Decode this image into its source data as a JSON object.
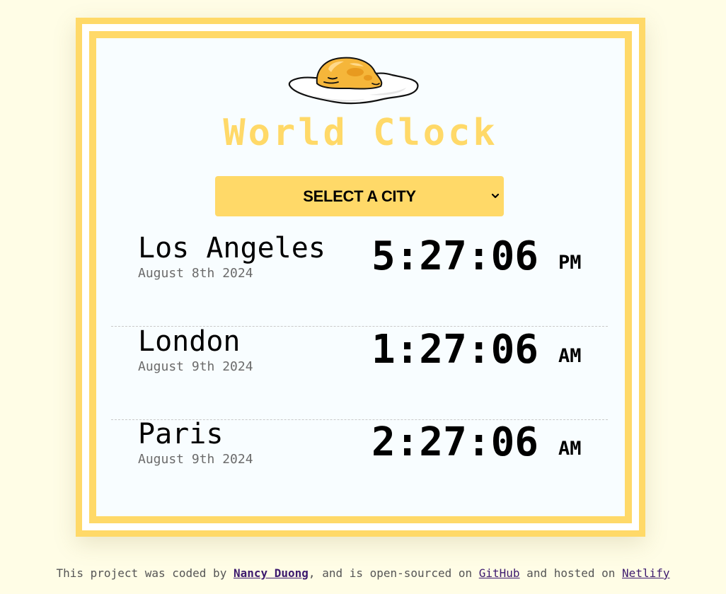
{
  "app": {
    "title": "World Clock"
  },
  "city_select": {
    "selected_label": "SELECT A CITY",
    "icon": "chevron-down-icon"
  },
  "cities": [
    {
      "name": "Los Angeles",
      "date": "August 8th 2024",
      "time": "5:27:06",
      "period": "PM"
    },
    {
      "name": "London",
      "date": "August 9th 2024",
      "time": "1:27:06",
      "period": "AM"
    },
    {
      "name": "Paris",
      "date": "August 9th 2024",
      "time": "2:27:06",
      "period": "AM"
    }
  ],
  "footer": {
    "text_1": "This project was coded by ",
    "author_link": "Nancy Duong",
    "text_2": ", and is open-sourced on ",
    "github_link": "GitHub",
    "text_3": " and hosted on ",
    "netlify_link": "Netlify"
  },
  "colors": {
    "accent": "#ffd968",
    "page_background": "#fffde6",
    "card_background": "#f8fdff",
    "link": "#3d1a6e"
  },
  "logo": {
    "icon": "gudetama-egg-icon"
  }
}
